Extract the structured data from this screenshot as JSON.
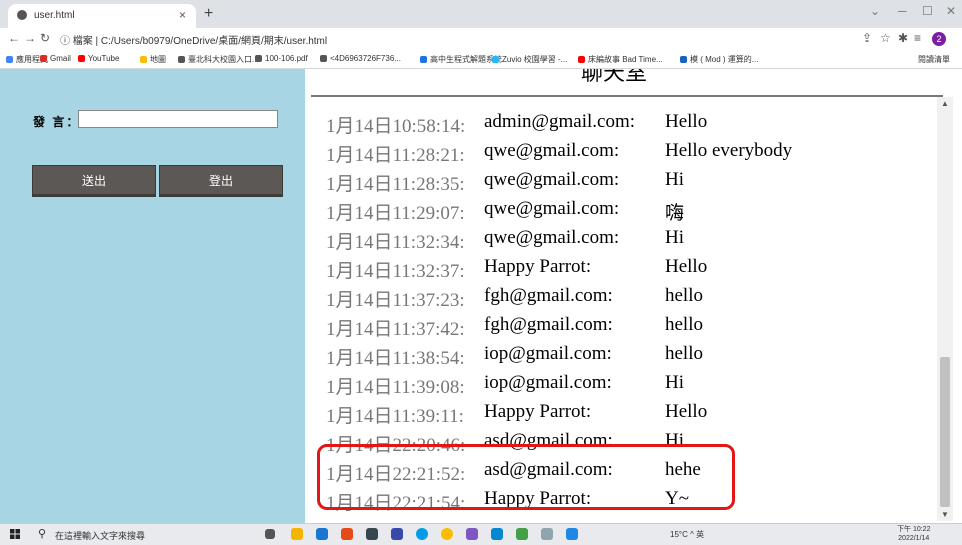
{
  "browser": {
    "tab_title": "user.html",
    "tab_close": "×",
    "new_tab": "+",
    "url_label": "ⓘ 檔案 | C:/Users/b0979/OneDrive/桌面/網頁/期末/user.html",
    "profile_badge": "2",
    "bookmarks": [
      {
        "label": "應用程式",
        "color": "#4285f4"
      },
      {
        "label": "Gmail",
        "color": "#d93025"
      },
      {
        "label": "YouTube",
        "color": "#ff0000"
      },
      {
        "label": "地圖",
        "color": "#fbbc04"
      },
      {
        "label": "臺北科大校園入口...",
        "color": "#555555"
      },
      {
        "label": "100-106.pdf",
        "color": "#555555"
      },
      {
        "label": "<4D6963726F736...",
        "color": "#555555"
      },
      {
        "label": "高中生程式解題系統",
        "color": "#1a73e8"
      },
      {
        "label": "Zuvio 校園學習 -...",
        "color": "#29b6f6"
      },
      {
        "label": "床編故事 Bad Time...",
        "color": "#ff0000"
      },
      {
        "label": "模 ( Mod ) 運算的...",
        "color": "#1565c0"
      }
    ],
    "reading_list": "閱讀清單"
  },
  "sidebar": {
    "speak_label": "發 言：",
    "speak_input_value": "",
    "send_button": "送出",
    "logout_button": "登出"
  },
  "chat": {
    "heading": "聊天室",
    "messages": [
      {
        "time": "1月14日10:58:14:",
        "user": "admin@gmail.com:",
        "text": "Hello"
      },
      {
        "time": "1月14日11:28:21:",
        "user": "qwe@gmail.com:",
        "text": "Hello everybody"
      },
      {
        "time": "1月14日11:28:35:",
        "user": "qwe@gmail.com:",
        "text": "Hi"
      },
      {
        "time": "1月14日11:29:07:",
        "user": "qwe@gmail.com:",
        "text": "嗨"
      },
      {
        "time": "1月14日11:32:34:",
        "user": "qwe@gmail.com:",
        "text": "Hi"
      },
      {
        "time": "1月14日11:32:37:",
        "user": "Happy Parrot:",
        "text": "Hello"
      },
      {
        "time": "1月14日11:37:23:",
        "user": "fgh@gmail.com:",
        "text": "hello"
      },
      {
        "time": "1月14日11:37:42:",
        "user": "fgh@gmail.com:",
        "text": "hello"
      },
      {
        "time": "1月14日11:38:54:",
        "user": "iop@gmail.com:",
        "text": "hello"
      },
      {
        "time": "1月14日11:39:08:",
        "user": "iop@gmail.com:",
        "text": "Hi"
      },
      {
        "time": "1月14日11:39:11:",
        "user": "Happy Parrot:",
        "text": "Hello"
      },
      {
        "time": "1月14日22:20:46:",
        "user": "asd@gmail.com:",
        "text": "Hi"
      },
      {
        "time": "1月14日22:21:52:",
        "user": "asd@gmail.com:",
        "text": "hehe"
      },
      {
        "time": "1月14日22:21:54:",
        "user": "Happy Parrot:",
        "text": "Y~"
      }
    ],
    "highlight_color": "#e31515"
  },
  "taskbar": {
    "search_placeholder": "在這裡輸入文字來搜尋",
    "tray_text": "15°C ^ 英",
    "clock_time": "下午 10:22",
    "clock_date": "2022/1/14"
  }
}
